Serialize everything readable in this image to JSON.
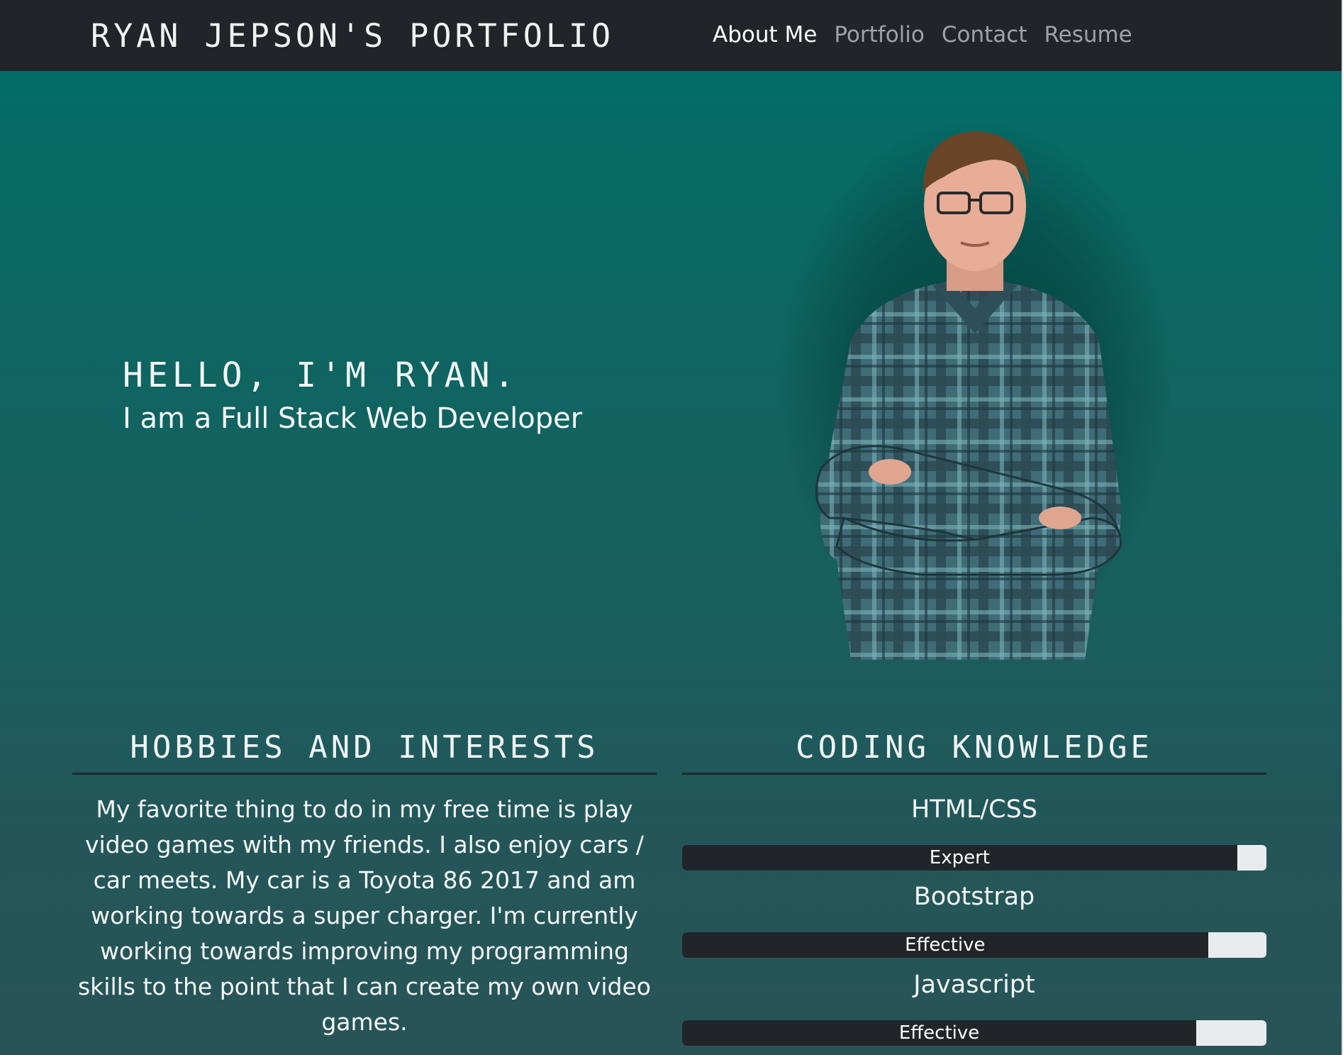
{
  "navbar": {
    "brand": "RYAN JEPSON'S PORTFOLIO",
    "links": [
      {
        "label": "About Me",
        "active": true
      },
      {
        "label": "Portfolio",
        "active": false
      },
      {
        "label": "Contact",
        "active": false
      },
      {
        "label": "Resume",
        "active": false
      }
    ]
  },
  "hero": {
    "greeting": "HELLO, I'M RYAN.",
    "title": "I am a Full Stack Web Developer",
    "portrait": "portrait photo of man in plaid shirt with arms crossed"
  },
  "hobbies": {
    "heading": "HOBBIES AND INTERESTS",
    "text": "My favorite thing to do in my free time is play video games with my friends. I also enjoy cars / car meets. My car is a Toyota 86 2017 and am working towards a super charger. I'm currently working towards improving my programming skills to the point that I can create my own video games."
  },
  "coding": {
    "heading": "CODING KNOWLEDGE",
    "skills": [
      {
        "name": "HTML/CSS",
        "level": "Expert",
        "percent": 95
      },
      {
        "name": "Bootstrap",
        "level": "Effective",
        "percent": 90
      },
      {
        "name": "Javascript",
        "level": "Effective",
        "percent": 88
      }
    ]
  },
  "colors": {
    "navbar": "#212529",
    "background_top": "#016e68",
    "background_bottom": "#285457",
    "bar_fill": "#212529",
    "bar_track": "#e9ecef"
  }
}
